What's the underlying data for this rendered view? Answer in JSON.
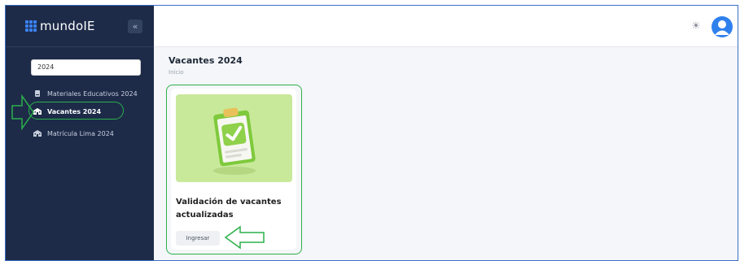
{
  "app": {
    "brand": "mundoIE"
  },
  "sidebar": {
    "search_value": "2024",
    "items": [
      {
        "label": "Materiales Educativos 2024",
        "icon": "book-icon",
        "active": false
      },
      {
        "label": "Vacantes 2024",
        "icon": "school-icon",
        "active": true
      },
      {
        "label": "Matrícula Lima 2024",
        "icon": "school-icon",
        "active": false
      }
    ]
  },
  "header": {
    "theme_icon": "sun-icon",
    "avatar_icon": "user-avatar-icon"
  },
  "main": {
    "title": "Vacantes 2024",
    "breadcrumb": "Inicio",
    "cards": [
      {
        "title": "Validación de vacantes actualizadas",
        "button_label": "Ingresar",
        "image_icon": "clipboard-check-icon"
      }
    ]
  },
  "colors": {
    "sidebar_bg": "#1d2b49",
    "accent": "#3b82f6",
    "highlight": "#2bb04a",
    "card_image_bg": "#c8e99a"
  }
}
